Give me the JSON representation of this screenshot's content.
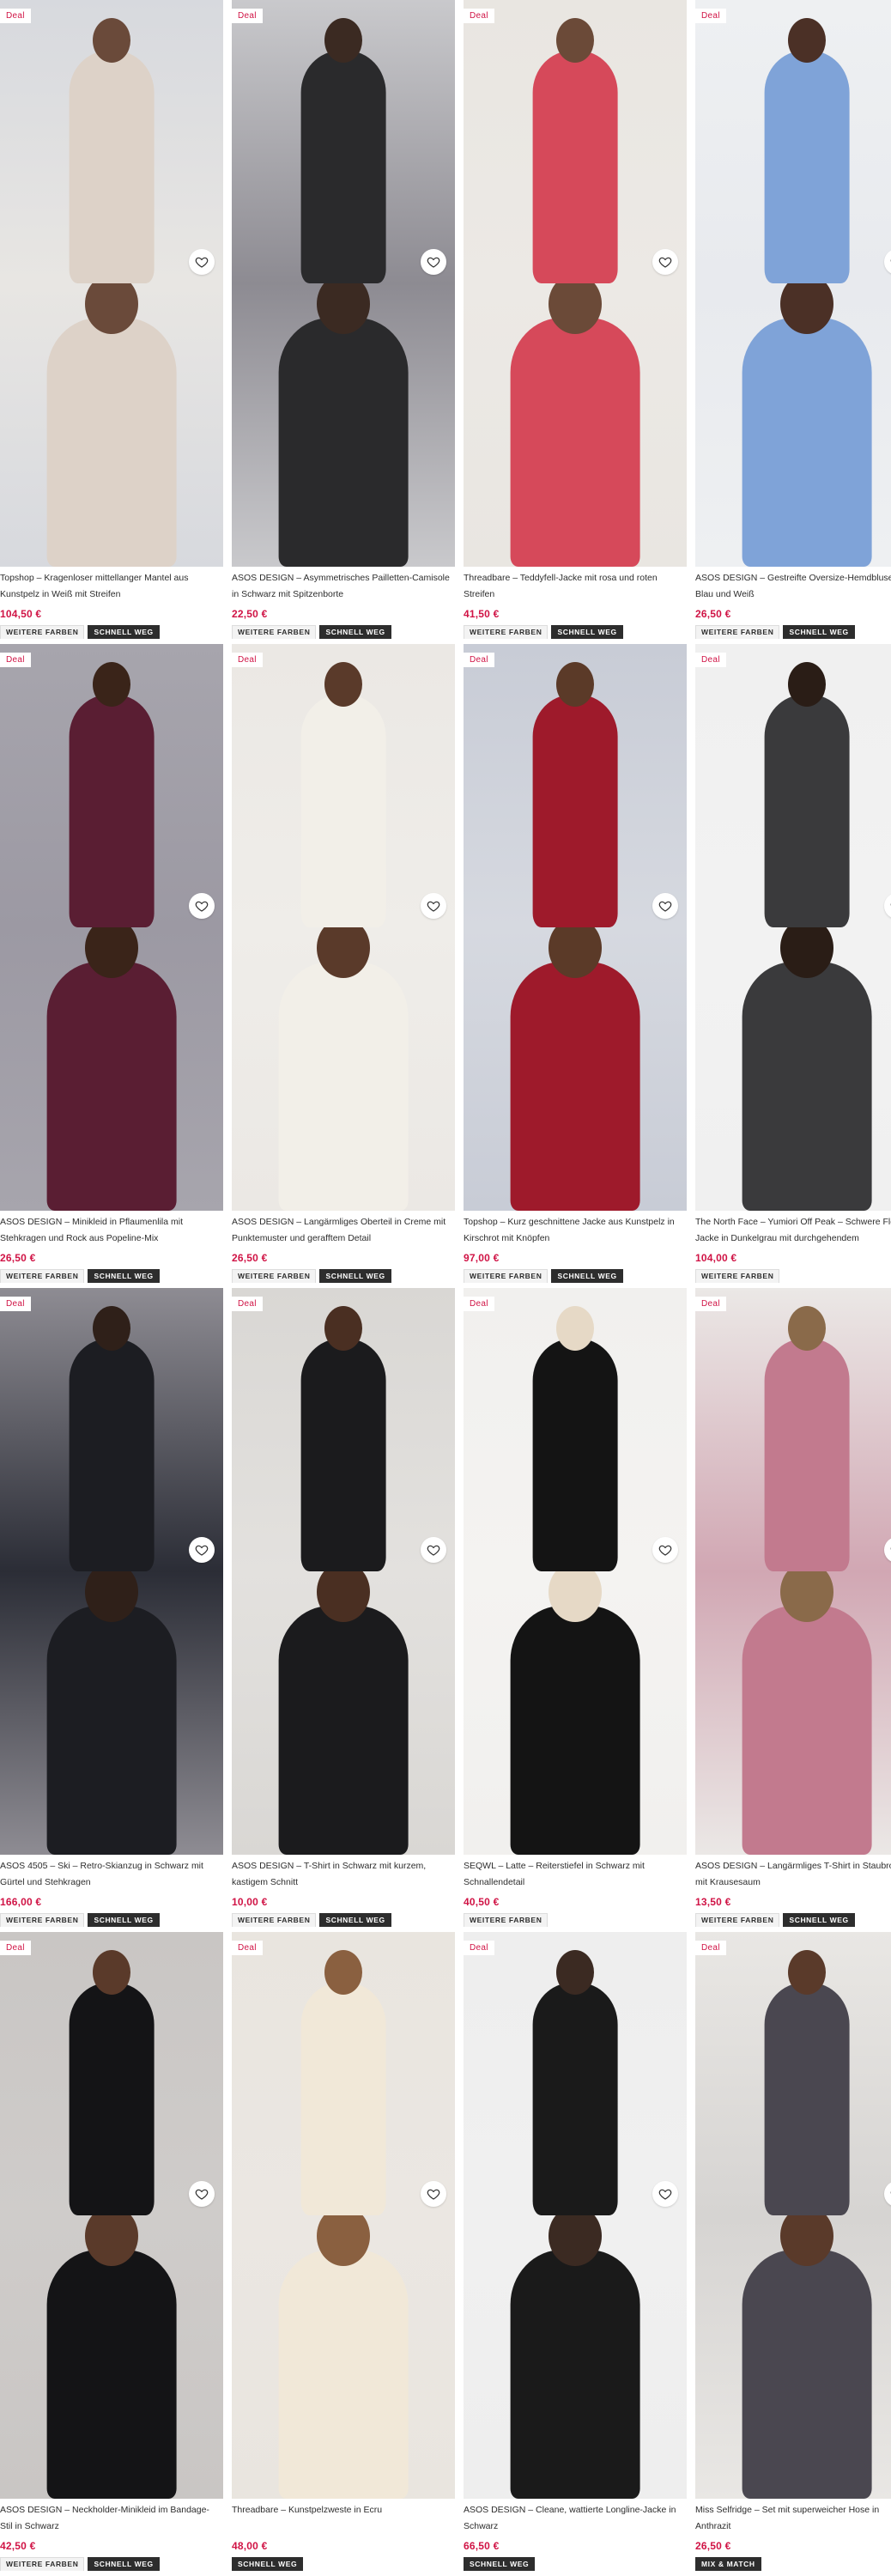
{
  "deal_label": "Deal",
  "products": [
    {
      "title": "Topshop – Kragenloser mittellanger Mantel aus Kunstpelz in Weiß mit Streifen",
      "price": "104,50 €",
      "deal": true,
      "badges": [
        "WEITERE FARBEN",
        "SCHNELL WEG"
      ],
      "colors": {
        "bg": "#d7d9de",
        "bg2": "#e8e6e3",
        "figure": "#ddd2c8",
        "head": "#6a4a3a"
      }
    },
    {
      "title": "ASOS DESIGN – Asymmetrisches Pailletten-Camisole in Schwarz mit Spitzenborte",
      "price": "22,50 €",
      "deal": true,
      "badges": [
        "WEITERE FARBEN",
        "SCHNELL WEG"
      ],
      "colors": {
        "bg": "#c9c9cc",
        "bg2": "#8d8b92",
        "figure": "#2a2a2c",
        "head": "#3b2a22"
      }
    },
    {
      "title": "Threadbare – Teddyfell-Jacke mit rosa und roten Streifen",
      "price": "41,50 €",
      "deal": true,
      "badges": [
        "WEITERE FARBEN",
        "SCHNELL WEG"
      ],
      "colors": {
        "bg": "#e9e6e1",
        "bg2": "#ece9e5",
        "figure": "#d6495a",
        "head": "#6b4a38"
      }
    },
    {
      "title": "ASOS DESIGN – Gestreifte Oversize-Hemdbluse in Blau und Weiß",
      "price": "26,50 €",
      "deal": true,
      "badges": [
        "WEITERE FARBEN",
        "SCHNELL WEG"
      ],
      "colors": {
        "bg": "#eef0f2",
        "bg2": "#e8eaee",
        "figure": "#7fa3d8",
        "head": "#4b3026"
      }
    },
    {
      "title": "ASOS DESIGN – Minikleid in Pflaumenlila mit Stehkragen und Rock aus Popeline-Mix",
      "price": "26,50 €",
      "deal": true,
      "badges": [
        "WEITERE FARBEN",
        "SCHNELL WEG"
      ],
      "colors": {
        "bg": "#a7a5ad",
        "bg2": "#9c99a3",
        "figure": "#5a1e33",
        "head": "#3a2419"
      }
    },
    {
      "title": "ASOS DESIGN – Langärmliges Oberteil in Creme mit Punktemuster und gerafftem Detail",
      "price": "26,50 €",
      "deal": true,
      "badges": [
        "WEITERE FARBEN",
        "SCHNELL WEG"
      ],
      "colors": {
        "bg": "#ebe8e4",
        "bg2": "#efede9",
        "figure": "#f2efe8",
        "head": "#5a3a2a"
      }
    },
    {
      "title": "Topshop – Kurz geschnittene Jacke aus Kunstpelz in Kirschrot mit Knöpfen",
      "price": "97,00 €",
      "deal": true,
      "badges": [
        "WEITERE FARBEN",
        "SCHNELL WEG"
      ],
      "colors": {
        "bg": "#c8ccd6",
        "bg2": "#d6d9e0",
        "figure": "#9e1a2b",
        "head": "#5b3a28"
      }
    },
    {
      "title": "The North Face – Yumiori Off Peak – Schwere Fleece-Jacke in Dunkelgrau mit durchgehendem",
      "price": "104,00 €",
      "deal": true,
      "badges": [
        "WEITERE FARBEN"
      ],
      "colors": {
        "bg": "#f0f0f0",
        "bg2": "#f2f2f2",
        "figure": "#3a3a3c",
        "head": "#2a1d16"
      }
    },
    {
      "title": "ASOS 4505 – Ski – Retro-Skianzug in Schwarz mit Gürtel und Stehkragen",
      "price": "166,00 €",
      "deal": true,
      "badges": [
        "WEITERE FARBEN",
        "SCHNELL WEG"
      ],
      "colors": {
        "bg": "#8e8c93",
        "bg2": "#2b2d36",
        "figure": "#1c1d22",
        "head": "#2f2019"
      }
    },
    {
      "title": "ASOS DESIGN – T-Shirt in Schwarz mit kurzem, kastigem Schnitt",
      "price": "10,00 €",
      "deal": true,
      "badges": [
        "WEITERE FARBEN",
        "SCHNELL WEG"
      ],
      "colors": {
        "bg": "#d9d7d4",
        "bg2": "#e3e1de",
        "figure": "#1b1b1d",
        "head": "#4a2f22"
      }
    },
    {
      "title": "SEQWL – Latte – Reiterstiefel in Schwarz mit Schnallendetail",
      "price": "40,50 €",
      "deal": true,
      "badges": [
        "WEITERE FARBEN"
      ],
      "colors": {
        "bg": "#f1f0ee",
        "bg2": "#f4f3f1",
        "figure": "#141414",
        "head": "#e6d9c6"
      }
    },
    {
      "title": "ASOS DESIGN – Langärmliges T-Shirt in Staubrosa mit Krausesaum",
      "price": "13,50 €",
      "deal": true,
      "badges": [
        "WEITERE FARBEN",
        "SCHNELL WEG"
      ],
      "colors": {
        "bg": "#ebe8e6",
        "bg2": "#d1a7b3",
        "figure": "#c27a8e",
        "head": "#8a6a4a"
      }
    },
    {
      "title": "ASOS DESIGN – Neckholder-Minikleid im Bandage-Stil in Schwarz",
      "price": "42,50 €",
      "deal": true,
      "badges": [
        "WEITERE FARBEN",
        "SCHNELL WEG"
      ],
      "colors": {
        "bg": "#c9c6c4",
        "bg2": "#cfccca",
        "figure": "#141416",
        "head": "#5a3a2a"
      }
    },
    {
      "title": "Threadbare – Kunstpelzweste in Ecru",
      "price": "48,00 €",
      "deal": true,
      "badges": [
        "SCHNELL WEG"
      ],
      "colors": {
        "bg": "#e9e5df",
        "bg2": "#ebe7e2",
        "figure": "#f1e8d8",
        "head": "#8a6040"
      }
    },
    {
      "title": "ASOS DESIGN – Cleane, wattierte Longline-Jacke in Schwarz",
      "price": "66,50 €",
      "deal": true,
      "badges": [
        "SCHNELL WEG"
      ],
      "colors": {
        "bg": "#eeeeee",
        "bg2": "#f0f0f0",
        "figure": "#1a1a1a",
        "head": "#3b2a22"
      }
    },
    {
      "title": "Miss Selfridge – Set mit superweicher Hose in Anthrazit",
      "price": "26,50 €",
      "deal": true,
      "badges": [
        "MIX & MATCH"
      ],
      "colors": {
        "bg": "#e9e7e4",
        "bg2": "#d6d4d2",
        "figure": "#4a4750",
        "head": "#5a3a2a"
      }
    }
  ]
}
